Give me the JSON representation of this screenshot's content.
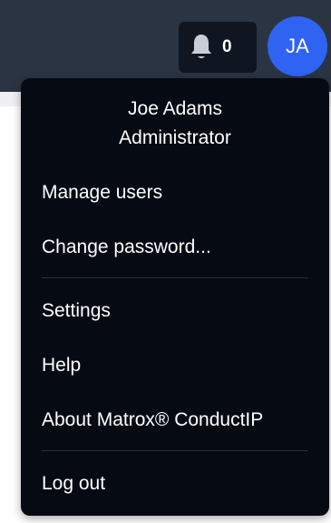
{
  "header": {
    "notifications": {
      "count": "0",
      "icon": "bell-icon"
    },
    "avatar": {
      "initials": "JA",
      "color": "#2f64f2"
    }
  },
  "user_menu": {
    "user_name": "Joe Adams",
    "user_role": "Administrator",
    "items": [
      {
        "label": "Manage users"
      },
      {
        "label": "Change password..."
      },
      {
        "label": "Settings"
      },
      {
        "label": "Help"
      },
      {
        "label": "About Matrox® ConductIP"
      },
      {
        "label": "Log out"
      }
    ],
    "background": "#060a13"
  }
}
